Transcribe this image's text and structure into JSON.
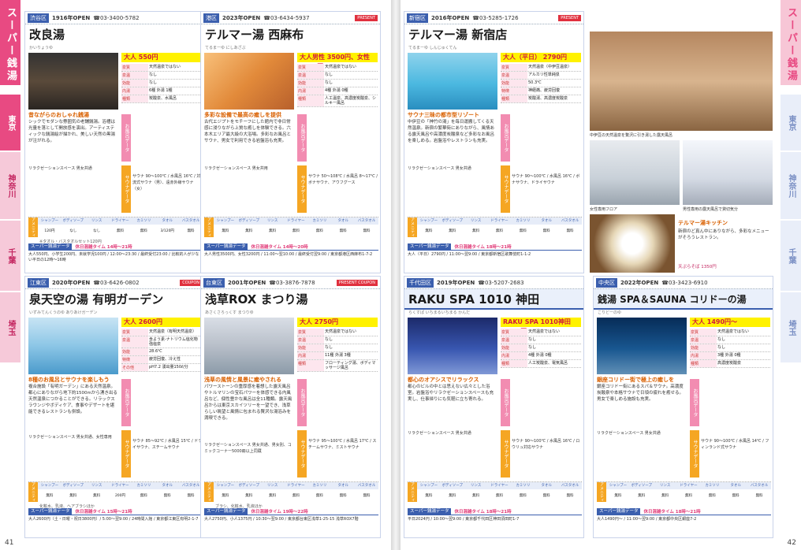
{
  "section_title": "スーパー銭湯",
  "left_tabs": [
    "東京",
    "神奈川",
    "千葉",
    "埼玉"
  ],
  "right_tabs": [
    "東京",
    "神奈川",
    "千葉",
    "埼玉"
  ],
  "page_numbers": {
    "left": "41",
    "right": "42"
  },
  "cards": [
    {
      "area": "渋谷区",
      "open": "1916年OPEN",
      "tel": "☎03-3400-5782",
      "badge": "",
      "name": "改良湯",
      "sub": "かいりょうゆ",
      "price": "大人 550円",
      "info": [
        [
          "",
          "天然温泉ではない"
        ],
        [
          "",
          "なし"
        ],
        [
          "",
          "なし"
        ],
        [
          "内湯",
          "6種 外湯 1種"
        ],
        [
          "",
          "炭酸泉、水風呂"
        ]
      ],
      "headline": "昔ながらのおしゃれ銭湯",
      "desc": "シックでモダンな雰囲気の老舗銭湯。浴槽は光量を落として開放感を演出。アーティスティックな銭湯絵が描かれ、美しい天然の黒湯が注がれる。",
      "facilities": "リラクゼーションスペース 男女共通",
      "sauna": "サウナ 90〜100℃ / 水風呂 16℃ / 対流式サウナ（男）、遠赤外線サウナ（女）",
      "amen_heads": [
        "シャンプー",
        "ボディソープ",
        "リンス",
        "ドライヤー",
        "カミソリ",
        "タオル",
        "バスタオル"
      ],
      "amen_vals": [
        "120円",
        "なし",
        "なし",
        "無料",
        "無料",
        "3/120円",
        "無料"
      ],
      "amen_note": "※タオル・バスタオルセット120円",
      "time_label": "スーパー銭湯データ",
      "time_text": "休日混雑タイム 14時〜21時",
      "notes": "大人550円、小学生200円、未就学児100円 / 12:00〜23:30 / 最終受付23:00 / 比較的人が少ない平日の12時〜16時"
    },
    {
      "area": "港区",
      "open": "2023年OPEN",
      "tel": "☎03-6434-5937",
      "badge": "PRESENT",
      "name": "テルマー湯 西麻布",
      "sub": "てるまーゆ にしあざぶ",
      "price": "大人男性 3500円、女性 3200円",
      "info": [
        [
          "",
          "天然温泉ではない"
        ],
        [
          "",
          "なし"
        ],
        [
          "",
          "なし"
        ],
        [
          "内湯",
          "4種 外湯 0種"
        ],
        [
          "",
          "人工温泉、高濃度炭酸泉、シルキー風呂"
        ]
      ],
      "headline": "多彩な設備で最高の癒しを提供",
      "desc": "古代エジプトをモチーフにした館内で非日常感に浸りながら上質な癒しを体験できる。六本木エリア最大級の大浴場。多彩なお風呂とサウナ、男女で利用できる岩盤浴も充実。",
      "facilities": "リラクゼーションスペース 男女共用",
      "sauna": "サウナ 50〜108℃ / 水風呂 8〜17℃ / ボナサウナ、アウフグース",
      "amen_heads": [
        "シャンプー",
        "ボディソープ",
        "リンス",
        "ドライヤー",
        "カミソリ",
        "タオル",
        "バスタオル"
      ],
      "amen_vals": [
        "無料",
        "無料",
        "無料",
        "無料",
        "無料",
        "無料",
        "無料"
      ],
      "amen_note": "",
      "time_label": "スーパー銭湯データ",
      "time_text": "休日混雑タイム 14時〜20時",
      "notes": "大人男性3500円、女性3200円 / 11:00〜翌10:00 / 最終受付翌9:00 / 東京都港区西麻布1-7-2"
    },
    {
      "area": "江東区",
      "open": "2020年OPEN",
      "tel": "☎03-6426-0802",
      "badge": "COUPON",
      "name": "泉天空の湯 有明ガーデン",
      "sub": "いずみてんくうのゆ ありあけガーデン",
      "price": "大人 2600円",
      "info": [
        [
          "",
          "天然温泉（有明天然温泉）"
        ],
        [
          "",
          "含よう素-ナトリウム塩化物強塩泉"
        ],
        [
          "",
          "28.6℃"
        ],
        [
          "",
          "疲労回復、冷え性"
        ],
        [
          "",
          "pH7.2 湧出量150ℓ/分"
        ]
      ],
      "headline": "8種のお風呂とサウナを楽しもう",
      "desc": "複合施設「有明ガーデン」にある天然温泉。都心にありながら地下約1500mから湧き出る天然温泉につかることができる。リラックスラウンジやボディケア、食事やデザートを堪能できるレストランも併設。",
      "facilities": "リラクゼーションスペース 男女共通、女性専用",
      "sauna": "サウナ 85〜92℃ / 水風呂 15℃ / ドライサウナ、スチームサウナ",
      "amen_heads": [
        "シャンプー",
        "ボディソープ",
        "リンス",
        "ドライヤー",
        "カミソリ",
        "タオル",
        "バスタオル"
      ],
      "amen_vals": [
        "無料",
        "無料",
        "無料",
        "200円",
        "無料",
        "無料",
        "無料"
      ],
      "amen_note": "化粧水、乳液、ヘアブラシほか",
      "time_label": "スーパー銭湯データ",
      "time_text": "休日混雑タイム 15時〜21時",
      "notes": "大人2600円（土・日曜・祝日3800円）/ 5:00〜翌9:00 / 24時間入館 / 東京都江東区有明2-1-7"
    },
    {
      "area": "台東区",
      "open": "2001年OPEN",
      "tel": "☎03-3876-7878",
      "badge": "PRESENT COUPON",
      "name": "浅草ROX まつり湯",
      "sub": "あさくさろっくす まつりゆ",
      "price": "大人 2750円",
      "info": [
        [
          "",
          "天然温泉ではない"
        ],
        [
          "",
          "なし"
        ],
        [
          "",
          "なし"
        ],
        [
          "内湯",
          "11種 外湯 3種"
        ],
        [
          "",
          "フローティング湯、ボディマッサージ風呂"
        ]
      ],
      "headline": "浅草の風情と風景に癒やされる",
      "desc": "パワーストーンの重厚感を着想した露天風呂やトルマリンの宝石パワーを体感できる内風呂など、個性豊かな風呂は全11種類。露天風呂からは東京スカイツリーを一望でき、浅草らしい眺望と風情に包まれる贅沢な湯浴みを満喫できる。",
      "facilities": "リラクゼーションスペース 男女共通、男女別、コミックコーナー5000冊以上同蔵",
      "sauna": "サウナ 95〜100℃ / 水風呂 17℃ / スチームサウナ、ミストサウナ",
      "amen_heads": [
        "シャンプー",
        "ボディソープ",
        "リンス",
        "ドライヤー",
        "カミソリ",
        "タオル",
        "バスタオル"
      ],
      "amen_vals": [
        "無料",
        "無料",
        "無料",
        "無料",
        "無料",
        "無料",
        "無料"
      ],
      "amen_note": "ブラシ、化粧水、乳液ほか",
      "time_label": "スーパー銭湯データ",
      "time_text": "休日混雑タイム 19時〜22時",
      "notes": "大人2750円、小人1375円 / 10:30〜翌9:00 / 東京都台東区浅草1-25-15 浅草ROX7階"
    },
    {
      "area": "新宿区",
      "open": "2016年OPEN",
      "tel": "☎03-5285-1726",
      "badge": "PRESENT",
      "name": "テルマー湯 新宿店",
      "sub": "てるまーゆ しんじゅくてん",
      "price": "大人（平日） 2790円",
      "info": [
        [
          "",
          "天然温泉（中伊豆温泉）"
        ],
        [
          "",
          "アルカリ性単純泉"
        ],
        [
          "",
          "50.3℃"
        ],
        [
          "",
          "神経痛、疲労回復"
        ],
        [
          "",
          "炭酸湯、高濃度炭酸泉"
        ]
      ],
      "headline": "サウナ三昧の都市型リゾート",
      "desc": "中伊豆の「神竹の湯」を毎日運搬してくる天然温泉。新宿の繁華街にありながら、風情ある露天風呂や高濃度炭酸泉など多彩なお風呂を楽しめる。岩盤浴やレストランも充実。",
      "facilities": "リラクゼーションスペース 男女共通",
      "sauna": "サウナ 90〜100℃ / 水風呂 16℃ / ボナサウナ、ドライサウナ",
      "amen_heads": [
        "シャンプー",
        "ボディソープ",
        "リンス",
        "ドライヤー",
        "カミソリ",
        "タオル",
        "バスタオル"
      ],
      "amen_vals": [
        "無料",
        "無料",
        "無料",
        "無料",
        "無料",
        "無料",
        "無料"
      ],
      "amen_note": "",
      "time_label": "スーパー銭湯データ",
      "time_text": "休日混雑タイム 18時〜21時",
      "notes": "大人（平日）2790円 / 11:00〜翌9:00 / 東京都新宿区歌舞伎町1-1-2"
    },
    {
      "area": "千代田区",
      "open": "2019年OPEN",
      "tel": "☎03-5207-2683",
      "badge": "",
      "name": "RAKU SPA 1010 神田",
      "sub": "らくすぱ いちまるいちまる かんだ",
      "price": "RAKU SPA 1010神田 2024円",
      "info": [
        [
          "",
          "天然温泉ではない"
        ],
        [
          "",
          "なし"
        ],
        [
          "",
          "なし"
        ],
        [
          "内湯",
          "4種 外湯 0種"
        ],
        [
          "",
          "人工炭酸泉、電気風呂"
        ]
      ],
      "headline": "都心のオアシスでリラックス",
      "desc": "都心のビルの中とは思えない広々とした浴室。岩盤浴やリラクゼーションスペースも充実し、仕事帰りにも気軽に立ち寄れる。",
      "facilities": "リラクゼーションスペース 男女共通",
      "sauna": "サウナ 90〜100℃ / 水風呂 16℃ / ロウリュ対応サウナ",
      "amen_heads": [
        "シャンプー",
        "ボディソープ",
        "リンス",
        "ドライヤー",
        "カミソリ",
        "タオル",
        "バスタオル"
      ],
      "amen_vals": [
        "無料",
        "無料",
        "無料",
        "無料",
        "無料",
        "無料",
        "無料"
      ],
      "amen_note": "",
      "time_label": "スーパー銭湯データ",
      "time_text": "休日混雑タイム 18時〜21時",
      "notes": "平日2024円 / 10:00〜翌9:00 / 東京都千代田区神田須田町1-7"
    },
    {
      "area": "中央区",
      "open": "2022年OPEN",
      "tel": "☎03-3423-6910",
      "badge": "",
      "name": "銭湯 SPA＆SAUNA コリドーの湯",
      "sub": "こりどーのゆ",
      "price": "大人 1490円〜",
      "info": [
        [
          "",
          "天然温泉ではない"
        ],
        [
          "",
          "なし"
        ],
        [
          "",
          "なし"
        ],
        [
          "内湯",
          "3種 外湯 0種"
        ],
        [
          "",
          "高濃度炭酸泉"
        ]
      ],
      "headline": "銀座コリドー街で極上の癒しを",
      "desc": "銀座コリドー街にあるスパ＆サウナ。高濃度炭酸泉や本格サウナで日頃の疲れを癒せる。男女で楽しめる施設も充実。",
      "facilities": "リラクゼーションスペース 男女共通",
      "sauna": "サウナ 90〜100℃ / 水風呂 14℃ / フィンランド式サウナ",
      "amen_heads": [
        "シャンプー",
        "ボディソープ",
        "リンス",
        "ドライヤー",
        "カミソリ",
        "タオル",
        "バスタオル"
      ],
      "amen_vals": [
        "無料",
        "無料",
        "無料",
        "無料",
        "無料",
        "無料",
        "無料"
      ],
      "amen_note": "",
      "time_label": "スーパー銭湯データ",
      "time_text": "休日混雑タイム 18時〜21時",
      "notes": "大人1490円〜 / 11:00〜翌9:00 / 東京都中央区銀座7-2"
    }
  ],
  "feature": {
    "cap1": "中伊豆の天然温泉を贅沢に引き湯した露天風呂",
    "cap2": "女性専用フロア",
    "cap3": "男性専用の露天風呂で貸切気分",
    "food_title": "テルマー湯キッチン",
    "food_text": "新宿のど真ん中にありながら、多彩なメニューがそろうレストラン。",
    "food_price": "天ぷらそば 1350円"
  }
}
